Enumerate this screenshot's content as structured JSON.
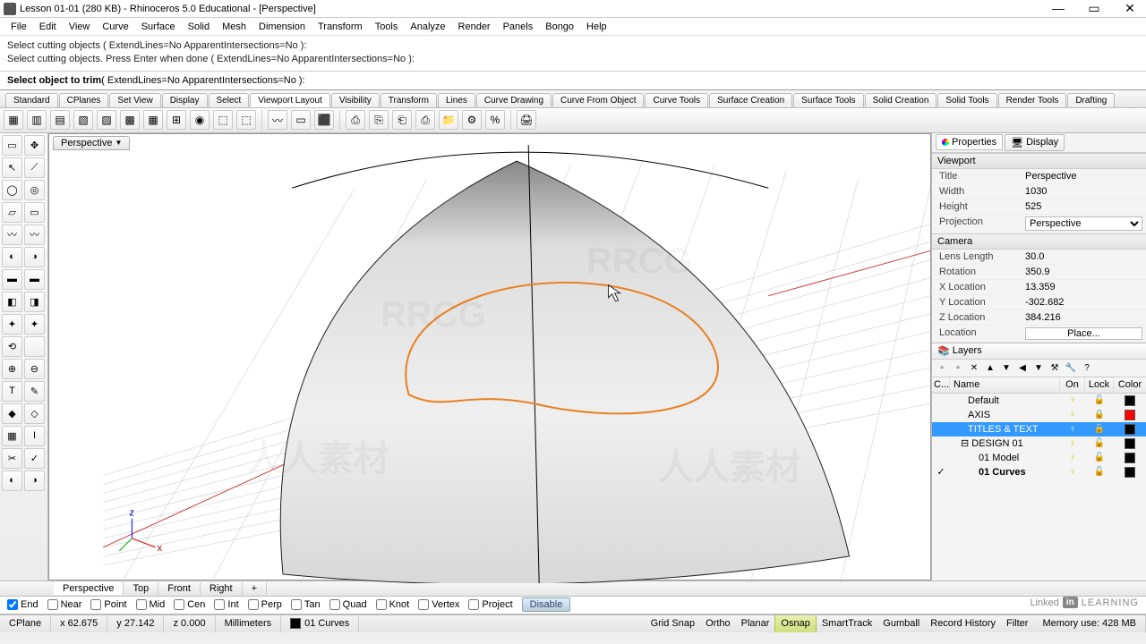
{
  "title": "Lesson 01-01 (280 KB) - Rhinoceros 5.0 Educational - [Perspective]",
  "menu": [
    "File",
    "Edit",
    "View",
    "Curve",
    "Surface",
    "Solid",
    "Mesh",
    "Dimension",
    "Transform",
    "Tools",
    "Analyze",
    "Render",
    "Panels",
    "Bongo",
    "Help"
  ],
  "history": [
    "Select cutting objects ( ExtendLines=No  ApparentIntersections=No ):",
    "Select cutting objects. Press Enter when done ( ExtendLines=No  ApparentIntersections=No ):"
  ],
  "prompt_bold": "Select object to trim",
  "prompt_rest": " ( ExtendLines=No  ApparentIntersections=No ):",
  "top_tabs": [
    "Standard",
    "CPlanes",
    "Set View",
    "Display",
    "Select",
    "Viewport Layout",
    "Visibility",
    "Transform",
    "Lines",
    "Curve Drawing",
    "Curve From Object",
    "Curve Tools",
    "Surface Creation",
    "Surface Tools",
    "Solid Creation",
    "Solid Tools",
    "Render Tools",
    "Drafting"
  ],
  "top_tabs_active": 5,
  "viewport_label": "Perspective",
  "right_tabs": {
    "properties": "Properties",
    "display": "Display"
  },
  "vp_section": "Viewport",
  "props": {
    "title": {
      "label": "Title",
      "val": "Perspective"
    },
    "width": {
      "label": "Width",
      "val": "1030"
    },
    "height": {
      "label": "Height",
      "val": "525"
    },
    "projection": {
      "label": "Projection",
      "val": "Perspective"
    }
  },
  "cam_section": "Camera",
  "cam": {
    "lens": {
      "label": "Lens Length",
      "val": "30.0"
    },
    "rot": {
      "label": "Rotation",
      "val": "350.9"
    },
    "x": {
      "label": "X Location",
      "val": "13.359"
    },
    "y": {
      "label": "Y Location",
      "val": "-302.682"
    },
    "z": {
      "label": "Z Location",
      "val": "384.216"
    },
    "loc": {
      "label": "Location",
      "val": "Place..."
    }
  },
  "layers_title": "Layers",
  "layer_cols": {
    "c": "C...",
    "name": "Name",
    "on": "On",
    "lock": "Lock",
    "color": "Color"
  },
  "layers": [
    {
      "name": "Default",
      "indent": 20,
      "on": true,
      "lock": false,
      "color": "#000",
      "sel": false,
      "bold": false,
      "check": false,
      "exp": ""
    },
    {
      "name": "AXIS",
      "indent": 20,
      "on": true,
      "lock": true,
      "color": "#f00",
      "sel": false,
      "bold": false,
      "check": false,
      "exp": ""
    },
    {
      "name": "TITLES & TEXT",
      "indent": 20,
      "on": true,
      "lock": true,
      "color": "#000",
      "sel": true,
      "bold": false,
      "check": false,
      "exp": ""
    },
    {
      "name": "DESIGN 01",
      "indent": 12,
      "on": true,
      "lock": false,
      "color": "#000",
      "sel": false,
      "bold": false,
      "check": false,
      "exp": "⊟"
    },
    {
      "name": "01 Model",
      "indent": 32,
      "on": true,
      "lock": false,
      "color": "#000",
      "sel": false,
      "bold": false,
      "check": false,
      "exp": ""
    },
    {
      "name": "01 Curves",
      "indent": 32,
      "on": true,
      "lock": false,
      "color": "#000",
      "sel": false,
      "bold": true,
      "check": true,
      "exp": ""
    }
  ],
  "view_tabs": [
    "Perspective",
    "Top",
    "Front",
    "Right"
  ],
  "view_tabs_active": 0,
  "view_tab_add": "+",
  "osnaps": [
    {
      "label": "End",
      "on": true
    },
    {
      "label": "Near",
      "on": false
    },
    {
      "label": "Point",
      "on": false
    },
    {
      "label": "Mid",
      "on": false
    },
    {
      "label": "Cen",
      "on": false
    },
    {
      "label": "Int",
      "on": false
    },
    {
      "label": "Perp",
      "on": false
    },
    {
      "label": "Tan",
      "on": false
    },
    {
      "label": "Quad",
      "on": false
    },
    {
      "label": "Knot",
      "on": false
    },
    {
      "label": "Vertex",
      "on": false
    },
    {
      "label": "Project",
      "on": false
    }
  ],
  "disable_btn": "Disable",
  "status": {
    "cplane": "CPlane",
    "x": "x 62.675",
    "y": "y 27.142",
    "z": "z 0.000",
    "units": "Millimeters",
    "layer": "01 Curves",
    "toggles": [
      "Grid Snap",
      "Ortho",
      "Planar",
      "Osnap",
      "SmartTrack",
      "Gumball",
      "Record History",
      "Filter"
    ],
    "toggles_active": [
      3
    ],
    "mem": "Memory use: 428 MB"
  },
  "li": {
    "brand": "Linked",
    "box": "in",
    "suffix": "LEARNING"
  }
}
